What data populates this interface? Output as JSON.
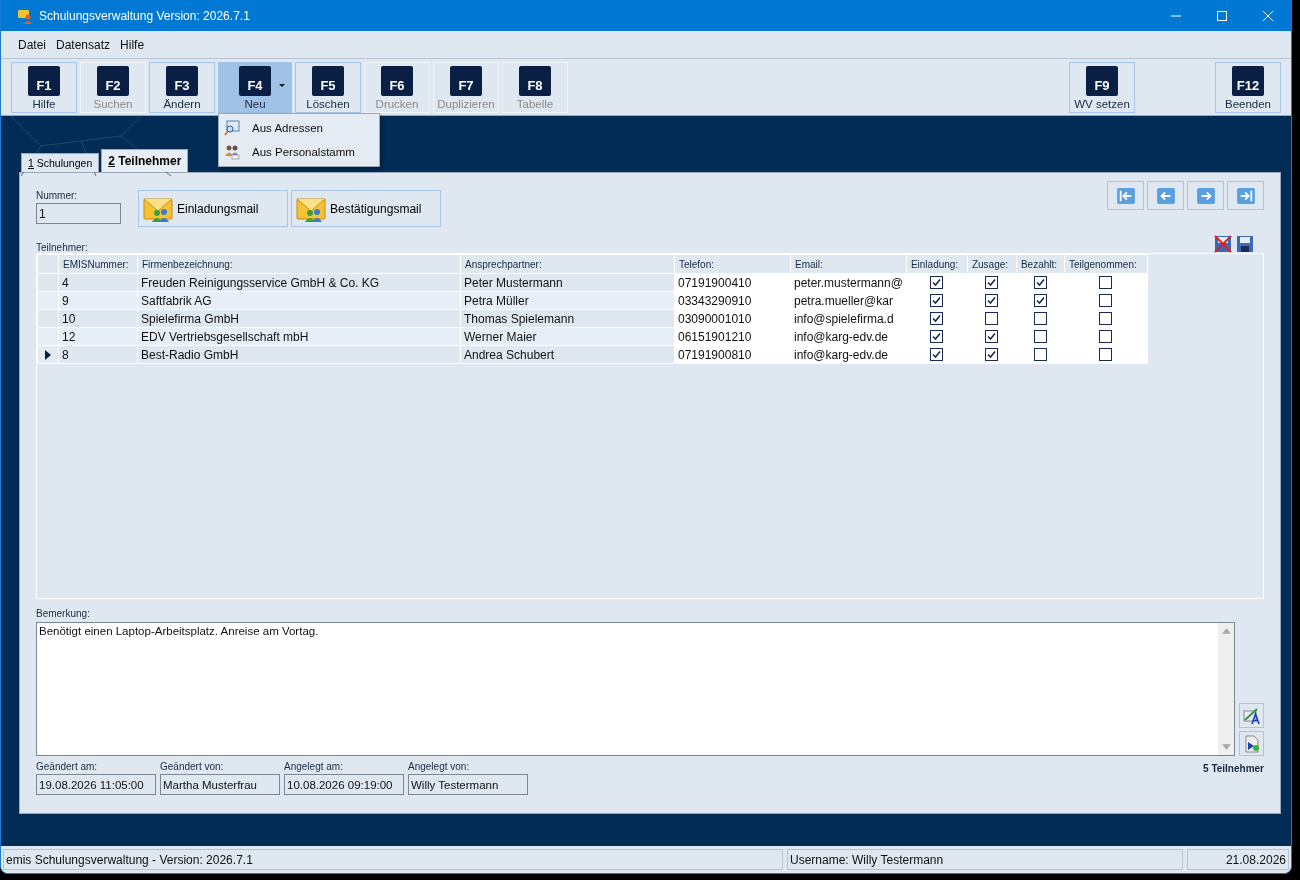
{
  "window": {
    "title": "Schulungsverwaltung Version: 2026.7.1"
  },
  "menu_bar": [
    {
      "label": "Datei"
    },
    {
      "label": "Datensatz"
    },
    {
      "label": "Hilfe"
    }
  ],
  "toolbar": {
    "left": [
      {
        "key": "F1",
        "label": "Hilfe",
        "disabled": false,
        "pressed": false,
        "dropdown": false
      },
      {
        "key": "F2",
        "label": "Suchen",
        "disabled": true,
        "pressed": false,
        "dropdown": false
      },
      {
        "key": "F3",
        "label": "Ändern",
        "disabled": false,
        "pressed": false,
        "dropdown": false
      },
      {
        "key": "F4",
        "label": "Neu",
        "disabled": false,
        "pressed": true,
        "dropdown": true
      },
      {
        "key": "F5",
        "label": "Löschen",
        "disabled": false,
        "pressed": false,
        "dropdown": false
      },
      {
        "key": "F6",
        "label": "Drucken",
        "disabled": true,
        "pressed": false,
        "dropdown": false
      },
      {
        "key": "F7",
        "label": "Duplizieren",
        "disabled": true,
        "pressed": false,
        "dropdown": false
      },
      {
        "key": "F8",
        "label": "Tabelle",
        "disabled": true,
        "pressed": false,
        "dropdown": false
      }
    ],
    "right": [
      {
        "key": "F9",
        "label": "WV setzen",
        "disabled": false,
        "pressed": false,
        "dropdown": false
      },
      {
        "key": "F12",
        "label": "Beenden",
        "disabled": false,
        "pressed": false,
        "dropdown": false
      }
    ]
  },
  "dropdown_menu": {
    "items": [
      {
        "label": "Aus Adressen",
        "kind": "search"
      },
      {
        "label": "Aus Personalstamm",
        "kind": "people"
      }
    ]
  },
  "tabs": [
    {
      "number": "1",
      "label": "Schulungen",
      "selected": false
    },
    {
      "number": "2",
      "label": "Teilnehmer",
      "selected": true
    }
  ],
  "nummer": {
    "label": "Nummer:",
    "value": "1"
  },
  "mail_buttons": [
    {
      "label": "Einladungsmail"
    },
    {
      "label": "Bestätigungsmail"
    }
  ],
  "grid": {
    "label": "Teilnehmer:",
    "columns": [
      "EMISNummer:",
      "Firmenbezeichnung:",
      "Ansprechpartner:",
      "Telefon:",
      "Email:",
      "Einladung:",
      "Zusage:",
      "Bezahlt:",
      "Teilgenommen:"
    ],
    "rows": [
      {
        "nummer": "4",
        "firma": "Freuden Reinigungsservice GmbH & Co. KG",
        "ansprechpartner": "Peter Mustermann",
        "telefon": "07191900410",
        "email": "peter.mustermann@",
        "einladung": true,
        "zusage": true,
        "bezahlt": true,
        "teilgenommen": false,
        "selected": false
      },
      {
        "nummer": "9",
        "firma": "Saftfabrik AG",
        "ansprechpartner": "Petra Müller",
        "telefon": "03343290910",
        "email": "petra.mueller@kar",
        "einladung": true,
        "zusage": true,
        "bezahlt": true,
        "teilgenommen": false,
        "selected": false
      },
      {
        "nummer": "10",
        "firma": "Spielefirma GmbH",
        "ansprechpartner": "Thomas Spielemann",
        "telefon": "03090001010",
        "email": "info@spielefirma.d",
        "einladung": true,
        "zusage": false,
        "bezahlt": false,
        "teilgenommen": false,
        "selected": false
      },
      {
        "nummer": "12",
        "firma": "EDV Vertriebsgesellschaft mbH",
        "ansprechpartner": "Werner Maier",
        "telefon": "06151901210",
        "email": "info@karg-edv.de",
        "einladung": true,
        "zusage": true,
        "bezahlt": false,
        "teilgenommen": false,
        "selected": false
      },
      {
        "nummer": "8",
        "firma": "Best-Radio GmbH",
        "ansprechpartner": "Andrea Schubert",
        "telefon": "07191900810",
        "email": "info@karg-edv.de",
        "einladung": true,
        "zusage": true,
        "bezahlt": false,
        "teilgenommen": false,
        "selected": true
      }
    ]
  },
  "bemerkung": {
    "label": "Bemerkung:",
    "value": "Benötigt einen Laptop-Arbeitsplatz. Anreise am Vortag."
  },
  "footer_fields": [
    {
      "label": "Geändert am:",
      "value": "19.08.2026 11:05:00"
    },
    {
      "label": "Geändert von:",
      "value": "Martha Musterfrau"
    },
    {
      "label": "Angelegt am:",
      "value": "10.08.2026 09:19:00"
    },
    {
      "label": "Angelegt von:",
      "value": "Willy Testermann"
    }
  ],
  "count": "5 Teilnehmer",
  "status_bar": [
    "emis Schulungsverwaltung - Version: 2026.7.1",
    "Username: Willy Testermann",
    "21.08.2026"
  ]
}
